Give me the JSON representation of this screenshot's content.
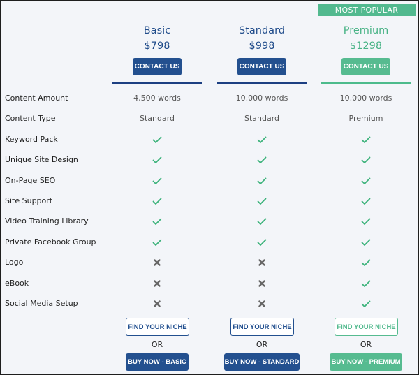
{
  "badge": "MOST POPULAR",
  "plans": [
    {
      "name": "Basic",
      "price": "$798",
      "contact": "CONTACT US",
      "niche": "FIND YOUR NICHE",
      "or": "OR",
      "buy": "BUY NOW - BASIC",
      "accent": "#23508f"
    },
    {
      "name": "Standard",
      "price": "$998",
      "contact": "CONTACT US",
      "niche": "FIND YOUR NICHE",
      "or": "OR",
      "buy": "BUY NOW - STANDARD",
      "accent": "#23508f"
    },
    {
      "name": "Premium",
      "price": "$1298",
      "contact": "CONTACT US",
      "niche": "FIND YOUR NICHE",
      "or": "OR",
      "buy": "BUY NOW - PREMIUM",
      "accent": "#56bb90"
    }
  ],
  "features": [
    {
      "label": "Content Amount",
      "values": [
        "4,500 words",
        "10,000 words",
        "10,000 words"
      ]
    },
    {
      "label": "Content Type",
      "values": [
        "Standard",
        "Standard",
        "Premium"
      ]
    },
    {
      "label": "Keyword Pack",
      "values": [
        "check",
        "check",
        "check"
      ]
    },
    {
      "label": "Unique Site Design",
      "values": [
        "check",
        "check",
        "check"
      ]
    },
    {
      "label": "On-Page SEO",
      "values": [
        "check",
        "check",
        "check"
      ]
    },
    {
      "label": "Site Support",
      "values": [
        "check",
        "check",
        "check"
      ]
    },
    {
      "label": "Video Training Library",
      "values": [
        "check",
        "check",
        "check"
      ]
    },
    {
      "label": "Private Facebook Group",
      "values": [
        "check",
        "check",
        "check"
      ]
    },
    {
      "label": "Logo",
      "values": [
        "cross",
        "cross",
        "check"
      ]
    },
    {
      "label": "eBook",
      "values": [
        "cross",
        "cross",
        "check"
      ]
    },
    {
      "label": "Social Media Setup",
      "values": [
        "cross",
        "cross",
        "check"
      ]
    }
  ],
  "colors": {
    "blue": "#23508f",
    "green": "#56bb90",
    "check": "#3bb27a",
    "cross": "#666666"
  }
}
